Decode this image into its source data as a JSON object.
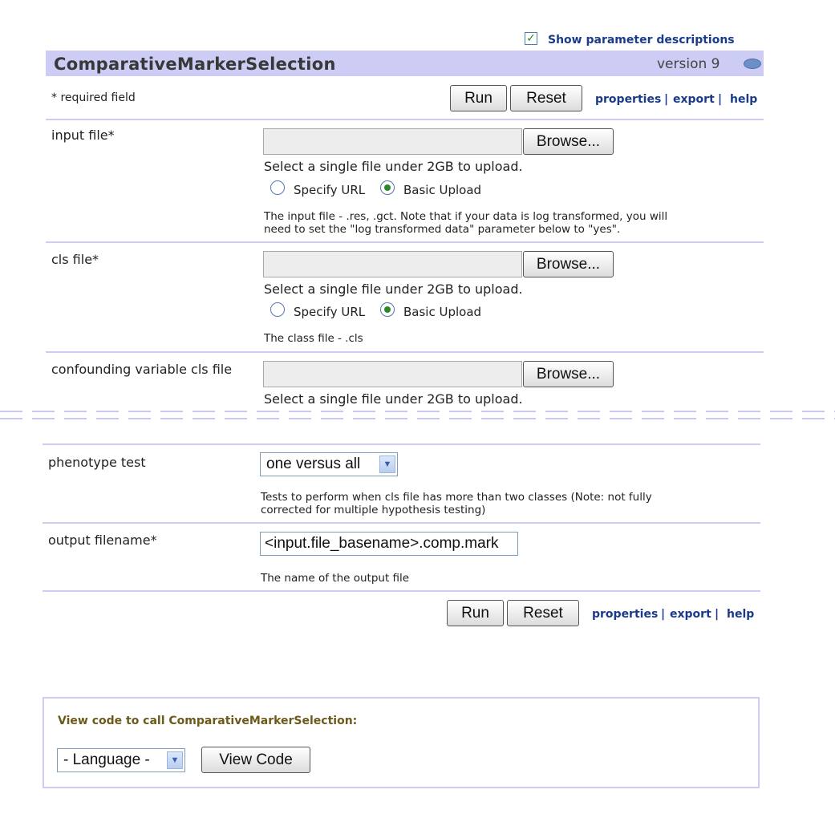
{
  "header": {
    "show_descriptions_checked": true,
    "show_descriptions_label": "Show parameter descriptions",
    "module_name": "ComparativeMarkerSelection",
    "version": "version 9",
    "toggle_icon": "eye-icon"
  },
  "toolbar_top": {
    "required_note": "* required field",
    "run_label": "Run",
    "reset_label": "Reset",
    "properties": "properties",
    "export": "export",
    "help": "help",
    "sep": "|"
  },
  "params": {
    "input_file": {
      "label": "input file*",
      "browse": "Browse...",
      "hint": "Select a single file under 2GB to upload.",
      "radio_url": "Specify URL",
      "radio_upload": "Basic Upload",
      "selected": "upload",
      "desc_line1": "The input file - .res, .gct. Note that if your data is log transformed, you will",
      "desc_line2": "need to set the \"log transformed data\" parameter below to \"yes\"."
    },
    "cls_file": {
      "label": "cls file*",
      "browse": "Browse...",
      "hint": "Select a single file under 2GB to upload.",
      "radio_url": "Specify URL",
      "radio_upload": "Basic Upload",
      "selected": "upload",
      "desc": "The class file - .cls"
    },
    "confounding": {
      "label": "confounding variable cls file",
      "browse": "Browse...",
      "hint": "Select a single file under 2GB to upload."
    },
    "phenotype_test": {
      "label": "phenotype test",
      "value": "one versus all",
      "desc_line1": "Tests to perform when cls file has more than two classes (Note: not fully",
      "desc_line2": "corrected for multiple hypothesis testing)"
    },
    "output_filename": {
      "label": "output filename*",
      "value": "<input.file_basename>.comp.mark",
      "desc": "The name of the output file"
    }
  },
  "toolbar_bottom": {
    "run_label": "Run",
    "reset_label": "Reset",
    "properties": "properties",
    "export": "export",
    "help": "help",
    "sep": "|"
  },
  "code_panel": {
    "title": "View code to call ComparativeMarkerSelection:",
    "language_value": "- Language -",
    "view_code_label": "View Code"
  },
  "colors": {
    "title_bar": "#ccccf5",
    "link": "#1a3a8a",
    "divider": "#ccccf5"
  }
}
